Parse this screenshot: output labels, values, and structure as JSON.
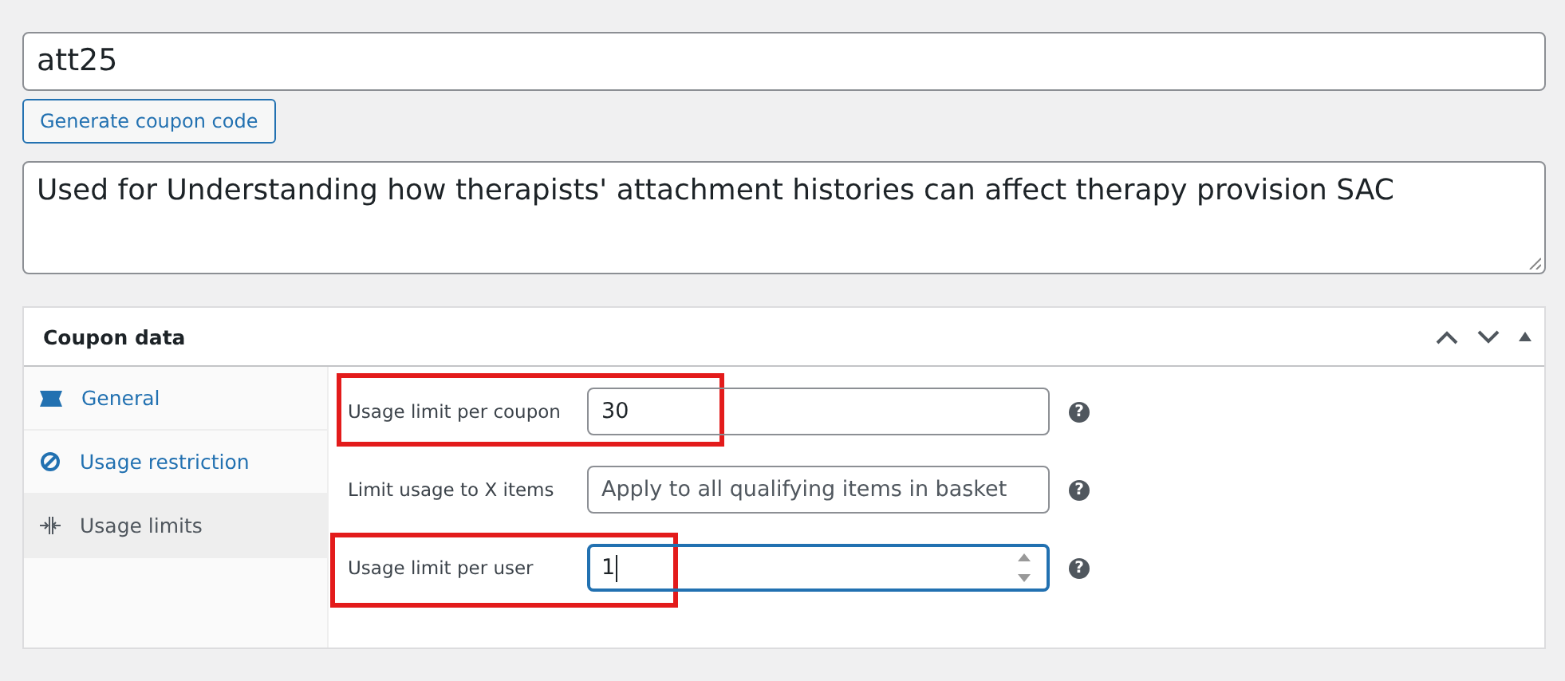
{
  "coupon_code": {
    "value": "att25"
  },
  "generate_button": {
    "label": "Generate coupon code"
  },
  "description": {
    "value": "Used for Understanding how therapists' attachment histories can affect therapy provision SAC"
  },
  "coupon_data": {
    "title": "Coupon data",
    "tabs": [
      {
        "label": "General",
        "selected": false
      },
      {
        "label": "Usage restriction",
        "selected": false
      },
      {
        "label": "Usage limits",
        "selected": true
      }
    ],
    "fields": [
      {
        "label": "Usage limit per coupon",
        "value": "30",
        "focused": false,
        "highlighted": true,
        "help": "?"
      },
      {
        "label": "Limit usage to X items",
        "placeholder": "Apply to all qualifying items in basket",
        "focused": false,
        "highlighted": false,
        "help": "?"
      },
      {
        "label": "Usage limit per user",
        "value": "1",
        "focused": true,
        "highlighted": true,
        "help": "?"
      }
    ]
  }
}
